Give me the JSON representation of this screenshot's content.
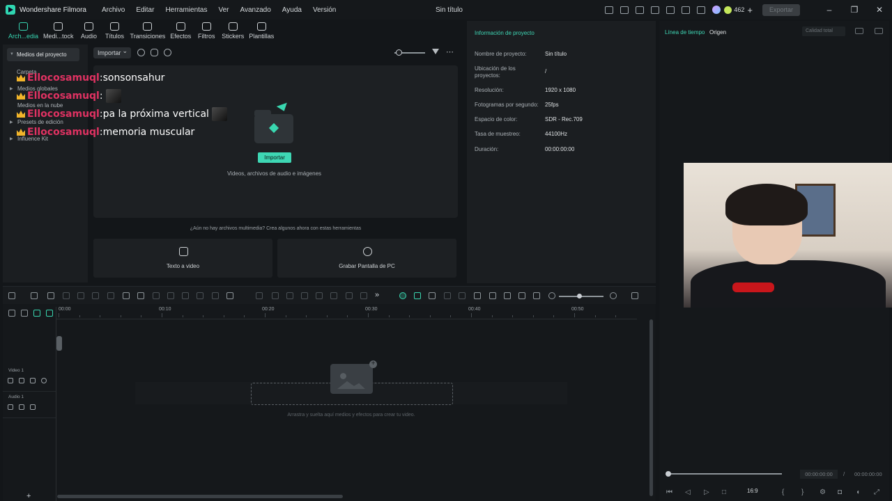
{
  "app": {
    "name": "Wondershare Filmora",
    "doc_title": "Sin título",
    "credits": "462",
    "export_label": "Exportar"
  },
  "menu": [
    "Archivo",
    "Editar",
    "Herramientas",
    "Ver",
    "Avanzado",
    "Ayuda",
    "Versión"
  ],
  "media_tabs": [
    "Arch...edia",
    "Medi...tock",
    "Audio",
    "Títulos",
    "Transiciones",
    "Efectos",
    "Filtros",
    "Stickers",
    "Plantillas"
  ],
  "sidebar": {
    "selected": "Medios del proyecto",
    "items": [
      "Carpeta",
      "Medios globales",
      "Medios en la nube",
      "Presets de edición",
      "Influence Kit"
    ]
  },
  "media": {
    "import_label": "Importar",
    "import_button": "Importar",
    "drop_hint": "Videos, archivos de audio e imágenes",
    "empty_hint": "¿Aún no hay archivos multimedia? Crea algunos ahora con estas herramientas",
    "tools": [
      "Texto a video",
      "Grabar Pantalla de PC"
    ]
  },
  "chat": [
    {
      "user": "Ellocosamuql",
      "message": "sonsonsahur",
      "emote": false
    },
    {
      "user": "Ellocosamuql",
      "message": "",
      "emote": true
    },
    {
      "user": "Ellocosamuql",
      "message": "pa la próxima vertical",
      "emote": true
    },
    {
      "user": "Ellocosamuql",
      "message": "memoria muscular",
      "emote": false
    }
  ],
  "project_info": {
    "title": "Información de proyecto",
    "rows": [
      {
        "key": "Nombre de proyecto:",
        "value": "Sin título"
      },
      {
        "key": "Ubicación de los proyectos:",
        "value": "/"
      },
      {
        "key": "Resolución:",
        "value": "1920 x 1080"
      },
      {
        "key": "Fotogramas por segundo:",
        "value": "25fps"
      },
      {
        "key": "Espacio de color:",
        "value": "SDR - Rec.709"
      },
      {
        "key": "Tasa de muestreo:",
        "value": "44100Hz"
      },
      {
        "key": "Duración:",
        "value": "00:00:00:00"
      }
    ]
  },
  "player": {
    "tabs": [
      "Línea de tiempo",
      "Origen"
    ],
    "quality": "Calidad total",
    "current_time": "00:00:00:00",
    "separator": "/",
    "total_time": "00:00:00:00",
    "ratio": "16:9"
  },
  "timeline": {
    "ruler": [
      "00:00",
      "00:10",
      "00:20",
      "00:30",
      "00:40",
      "00:50"
    ],
    "tracks": [
      {
        "label": "Video 1"
      },
      {
        "label": "Audio 1"
      }
    ],
    "drop_hint": "Arrastra y suelta aquí medios y efectos para crear tu video."
  },
  "colors": {
    "accent": "#3ed7b4",
    "chat_user": "#e03262",
    "crown": "#f2b52a"
  }
}
